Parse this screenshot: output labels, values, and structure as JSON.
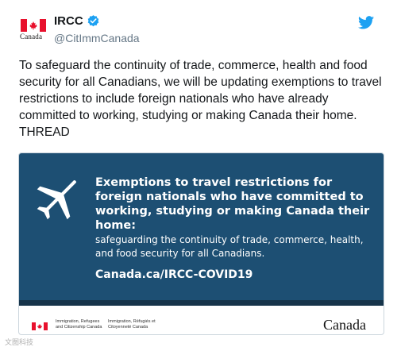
{
  "account": {
    "display_name": "IRCC",
    "handle": "@CitImmCanada",
    "avatar_wordmark": "Canada",
    "verified": true
  },
  "tweet": {
    "text": "To safeguard the continuity of trade, commerce, health and food security for all Canadians, we will be updating exemptions to travel restrictions to include foreign nationals who have already committed to working, studying or making Canada their home. THREAD"
  },
  "card": {
    "headline": "Exemptions to travel restrictions for foreign nationals who have committed to working, studying or making Canada their home:",
    "subtext": "safeguarding the continuity of trade, commerce, health, and food security for all Canadians.",
    "url": "Canada.ca/IRCC-COVID19",
    "dept_en": "Immigration, Refugees and Citizenship Canada",
    "dept_fr": "Immigration, Réfugiés et Citoyenneté Canada",
    "wordmark": "Canada"
  },
  "watermark": "文图科技",
  "colors": {
    "card_background": "#1d4f73",
    "card_bottom_bar": "#16344a",
    "twitter_blue": "#1da1f2",
    "canada_red": "#e8112d"
  },
  "icons": [
    "canada-flag-icon",
    "verified-badge-icon",
    "twitter-bird-icon",
    "airplane-icon"
  ]
}
